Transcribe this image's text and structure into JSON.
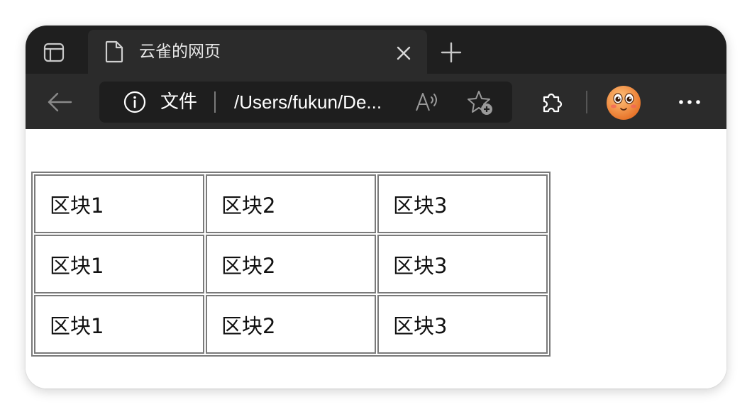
{
  "browser": {
    "tab": {
      "title": "云雀的网页",
      "page_icon": "page-icon",
      "close_icon": "close-icon"
    },
    "tab_actions_icon": "tab-actions-icon",
    "new_tab_icon": "plus-icon",
    "toolbar": {
      "back_icon": "back-arrow-icon",
      "address": {
        "info_icon": "info-icon",
        "scheme_label": "文件",
        "url": "/Users/fukun/De...",
        "read_aloud_icon": "read-aloud-icon",
        "favorite_icon": "add-favorite-icon"
      },
      "extensions_icon": "puzzle-icon",
      "avatar_icon": "avatar-icon",
      "more_icon": "more-icon"
    },
    "colors": {
      "tabbar_bg": "#1f1f1f",
      "toolbar_bg": "#2b2b2b",
      "address_bg": "#1e1e1e"
    }
  },
  "table": {
    "rows": [
      [
        "区块1",
        "区块2",
        "区块3"
      ],
      [
        "区块1",
        "区块2",
        "区块3"
      ],
      [
        "区块1",
        "区块2",
        "区块3"
      ]
    ]
  }
}
